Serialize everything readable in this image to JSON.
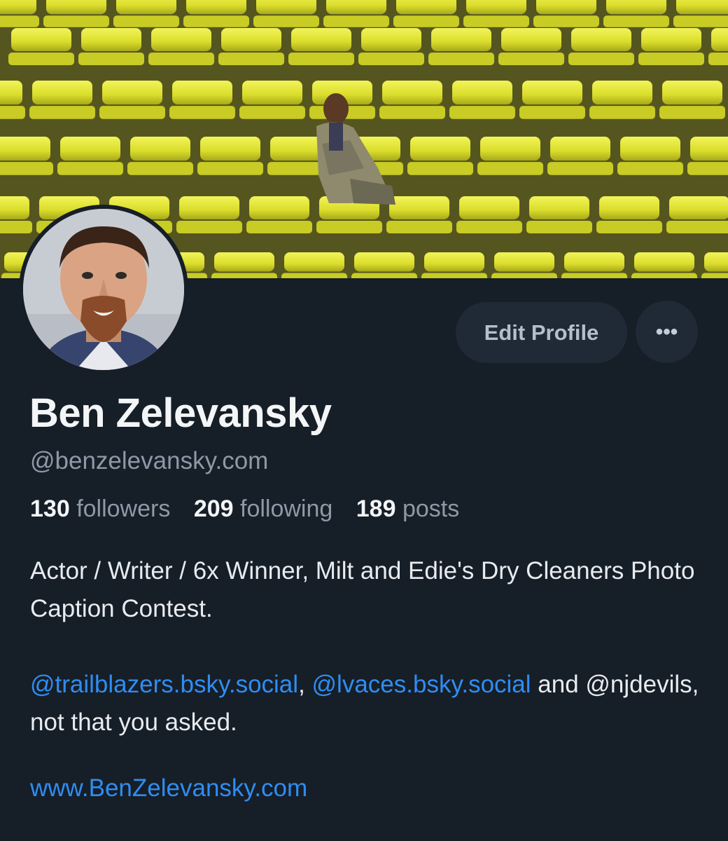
{
  "profile": {
    "display_name": "Ben Zelevansky",
    "handle": "@benzelevansky.com",
    "stats": {
      "followers_count": "130",
      "followers_label": "followers",
      "following_count": "209",
      "following_label": "following",
      "posts_count": "189",
      "posts_label": "posts"
    },
    "bio": {
      "line1": "Actor / Writer / 6x Winner, Milt and Edie's Dry Cleaners Photo Caption Contest.",
      "mention1": "@trailblazers.bsky.social",
      "sep": ", ",
      "mention2": "@lvaces.bsky.social",
      "and_text": " and @njdevils, not that you asked."
    },
    "website": "www.BenZelevansky.com"
  },
  "actions": {
    "edit_profile_label": "Edit Profile",
    "more_icon": "more-horizontal-icon",
    "more_glyph": "•••"
  },
  "colors": {
    "background": "#161e27",
    "button_bg": "#1f2a36",
    "link": "#2f8df2",
    "muted": "#8d99a7",
    "seat_yellow": "#e3e62c"
  }
}
